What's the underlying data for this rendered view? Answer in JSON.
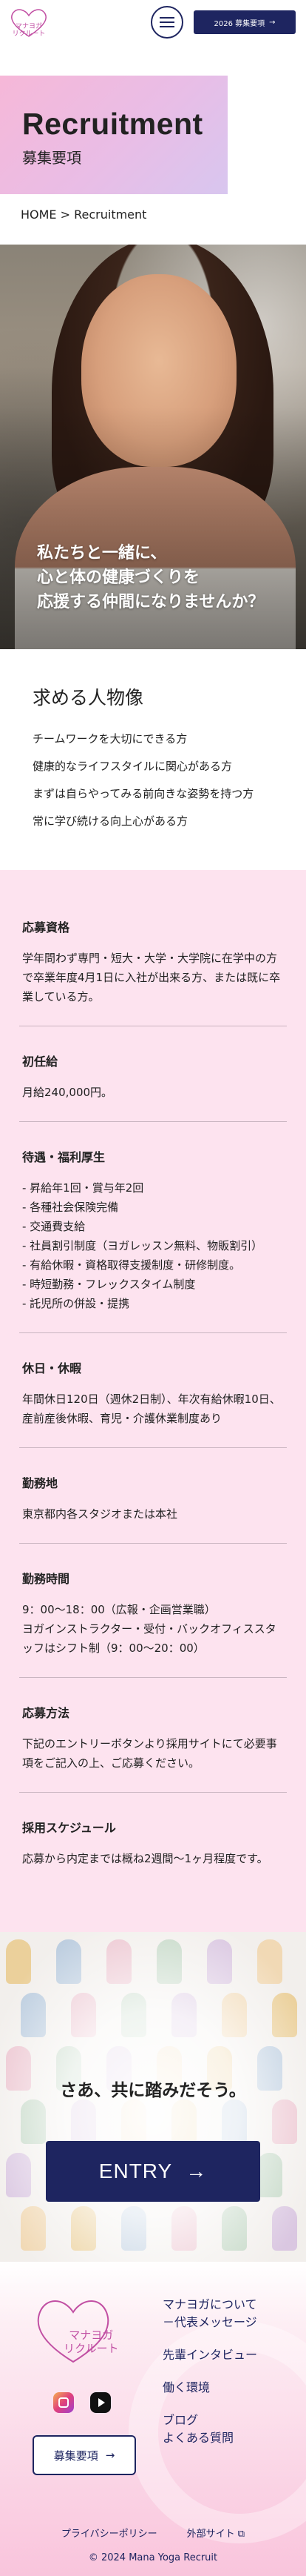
{
  "header": {
    "logo_text_line1": "マナヨガ",
    "logo_text_line2": "リクルート",
    "entry_label": "2026 募集要項",
    "entry_year_sup": "2026"
  },
  "title": {
    "en": "Recruitment",
    "ja": "募集要項"
  },
  "breadcrumb": "HOME > Recruitment",
  "hero": {
    "line1": "私たちと一緒に、",
    "line2": "心と体の健康づくりを",
    "line3": "応援する仲間になりませんか？"
  },
  "persona": {
    "heading": "求める人物像",
    "items": [
      "チームワークを大切にできる方",
      "健康的なライフスタイルに関心がある方",
      "まずは自らやってみる前向きな姿勢を持つ方",
      "常に学び続ける向上心がある方"
    ]
  },
  "requirements": [
    {
      "heading": "応募資格",
      "body": "学年問わず専門・短大・大学・大学院に在学中の方で卒業年度4月1日に入社が出来る方、または既に卒業している方。"
    },
    {
      "heading": "初任給",
      "body": "月給240,000円。"
    },
    {
      "heading": "待遇・福利厚生",
      "body": "- 昇給年1回・賞与年2回\n- 各種社会保険完備\n- 交通費支給\n- 社員割引制度（ヨガレッスン無料、物販割引）\n- 有給休暇・資格取得支援制度・研修制度。\n- 時短勤務・フレックスタイム制度\n- 託児所の併設・提携"
    },
    {
      "heading": "休日・休暇",
      "body": "年間休日120日（週休2日制）、年次有給休暇10日、産前産後休暇、育児・介護休業制度あり"
    },
    {
      "heading": "勤務地",
      "body": "東京都内各スタジオまたは本社"
    },
    {
      "heading": "勤務時間",
      "body": "9：00～18：00（広報・企画営業職）\nヨガインストラクター・受付・バックオフィススタッフはシフト制（9：00～20：00）"
    },
    {
      "heading": "応募方法",
      "body": "下記のエントリーボタンより採用サイトにて必要事項をご記入の上、ご応募ください。"
    },
    {
      "heading": "採用スケジュール",
      "body": "応募から内定までは概ね2週間〜1ヶ月程度です。"
    }
  ],
  "cta": {
    "heading": "さあ、共に踏みだそう。",
    "button": "ENTRY",
    "arrow": "→"
  },
  "footer": {
    "logo_line1": "マナヨガ",
    "logo_line2": "リクルート",
    "requirements_button": "募集要項",
    "arrow": "→",
    "nav": [
      "マナヨガについて",
      "－代表メッセージ",
      "先輩インタビュー",
      "働く環境",
      "ブログ",
      "よくある質問"
    ],
    "privacy": "プライバシーポリシー",
    "external": "外部サイト",
    "copyright": "© 2024 Mana Yoga Recruit"
  },
  "colors": {
    "navy": "#1e2560",
    "pink": "#f6b8d8",
    "pink_bg": "#fde3ef",
    "logo_pink": "#c14fa3"
  },
  "icons": [
    "hamburger-icon",
    "arrow-right-icon",
    "instagram-icon",
    "youtube-icon",
    "external-link-icon"
  ]
}
